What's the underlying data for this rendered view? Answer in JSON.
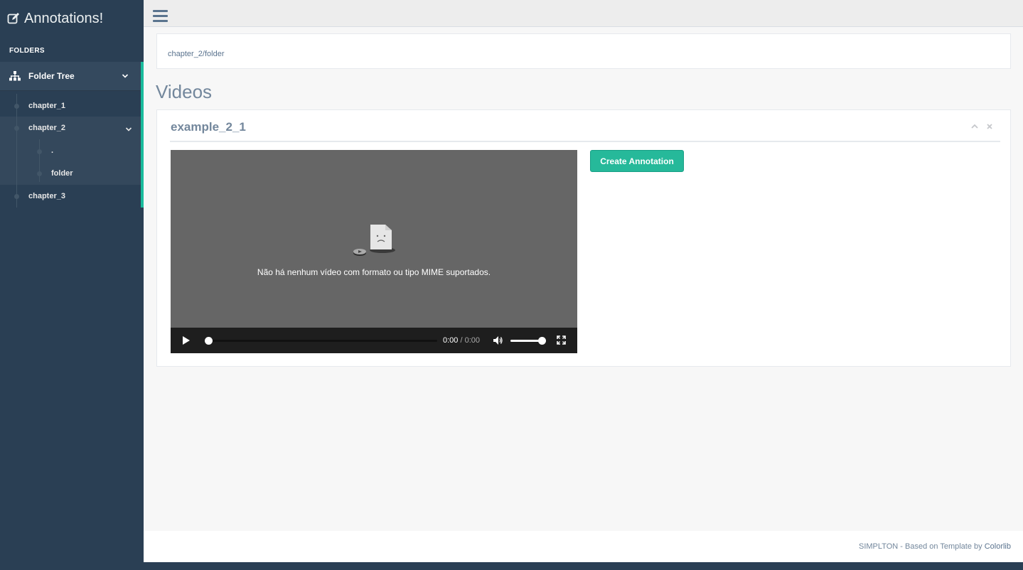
{
  "brand": {
    "title": "Annotations!",
    "icon": "edit-icon"
  },
  "sidebar": {
    "section_title": "FOLDERS",
    "tree_label": "Folder Tree",
    "tree_icon": "sitemap-icon",
    "nodes": {
      "chapter_1": "chapter_1",
      "chapter_2": "chapter_2",
      "dot": ".",
      "folder": "folder",
      "chapter_3": "chapter_3"
    },
    "accent_color": "#1abb9c"
  },
  "breadcrumb": "chapter_2/folder",
  "page_title": "Videos",
  "panel": {
    "title": "example_2_1",
    "video": {
      "message": "Não há nenhum vídeo com formato ou tipo MIME suportados.",
      "time_current": "0:00",
      "time_separator": "/",
      "time_total": "0:00",
      "progress": 0,
      "volume": 1.0
    },
    "create_button": "Create Annotation",
    "button_color": "#26b99a"
  },
  "footer": {
    "text": "SIMPLTON - Based on Template by ",
    "link": "Colorlib"
  }
}
